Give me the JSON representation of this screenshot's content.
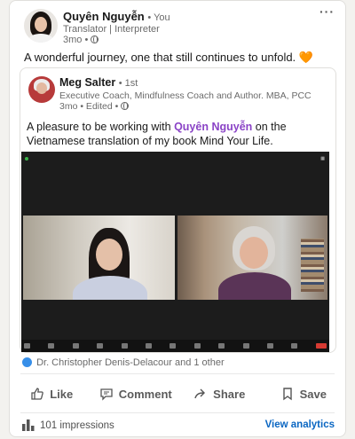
{
  "post": {
    "author": {
      "name": "Quyên Nguyễn",
      "relation": "• You",
      "headline": "Translator | Interpreter",
      "time": "3mo •"
    },
    "more_icon": "ellipsis-icon",
    "text": "A wonderful journey, one that still continues to unfold.",
    "emoji": "🧡"
  },
  "reshared": {
    "author": {
      "name": "Meg Salter",
      "relation": "• 1st",
      "headline": "Executive Coach, Mindfulness Coach and Author. MBA, PCC",
      "time": "3mo • Edited •"
    },
    "text_before": "A pleasure to be working with ",
    "mention": "Quyên Nguyễn",
    "text_after": " on the Vietnamese translation of my book Mind Your Life."
  },
  "reactions": {
    "summary": "Dr. Christopher Denis-Delacour and 1 other"
  },
  "actions": {
    "like": "Like",
    "comment": "Comment",
    "share": "Share",
    "save": "Save"
  },
  "footer": {
    "impressions": "101 impressions",
    "analytics": "View analytics"
  },
  "colors": {
    "mention": "#8a43c6",
    "link": "#0a66c2",
    "like": "#378fe9",
    "heart": "#e67e22"
  }
}
